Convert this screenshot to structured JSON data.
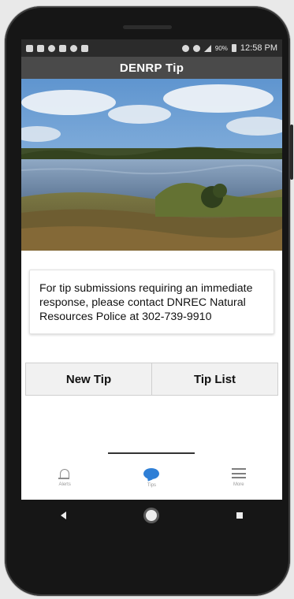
{
  "status_bar": {
    "battery": "90%",
    "time": "12:58 PM"
  },
  "app_bar": {
    "title": "DENRP Tip"
  },
  "notice": {
    "text": "For tip submissions requiring an immediate response, please contact DNREC Natural Resources Police at 302-739-9910"
  },
  "actions": {
    "new_tip": "New Tip",
    "tip_list": "Tip List"
  },
  "bottom_nav": {
    "items": [
      {
        "label": "Alerts",
        "icon": "bell-icon"
      },
      {
        "label": "Tips",
        "icon": "chat-bubble-icon",
        "active": true
      },
      {
        "label": "More",
        "icon": "hamburger-menu-icon"
      }
    ],
    "active_color": "#2f7fd6"
  },
  "system_nav": {
    "icons": [
      "back-icon",
      "home-icon",
      "recent-apps-icon"
    ]
  }
}
